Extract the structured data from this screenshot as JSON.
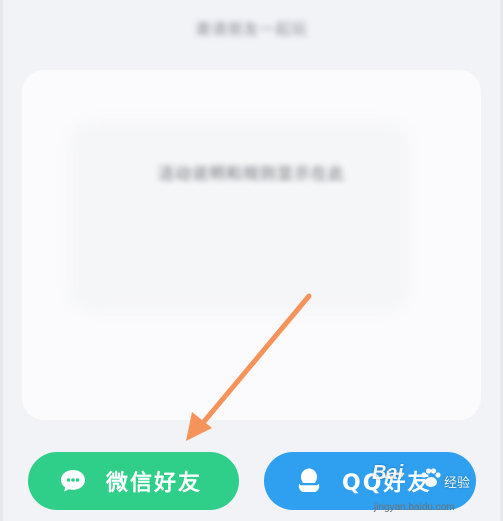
{
  "share_sheet": {
    "title": "邀请朋友一起玩",
    "preview_text": "活动说明和规则显示在此"
  },
  "buttons": {
    "wechat": {
      "label": "微信好友",
      "icon": "wechat-chat-icon",
      "color": "#2fcf8a"
    },
    "qq": {
      "label": "QQ好友",
      "icon": "qq-penguin-icon",
      "color": "#2f9ff0"
    }
  },
  "annotation": {
    "icon": "orange-arrow-icon",
    "color": "#f5935a"
  },
  "watermark": {
    "logo": "Bai",
    "brand": "经验",
    "url": "jingyan.baidu.com"
  }
}
